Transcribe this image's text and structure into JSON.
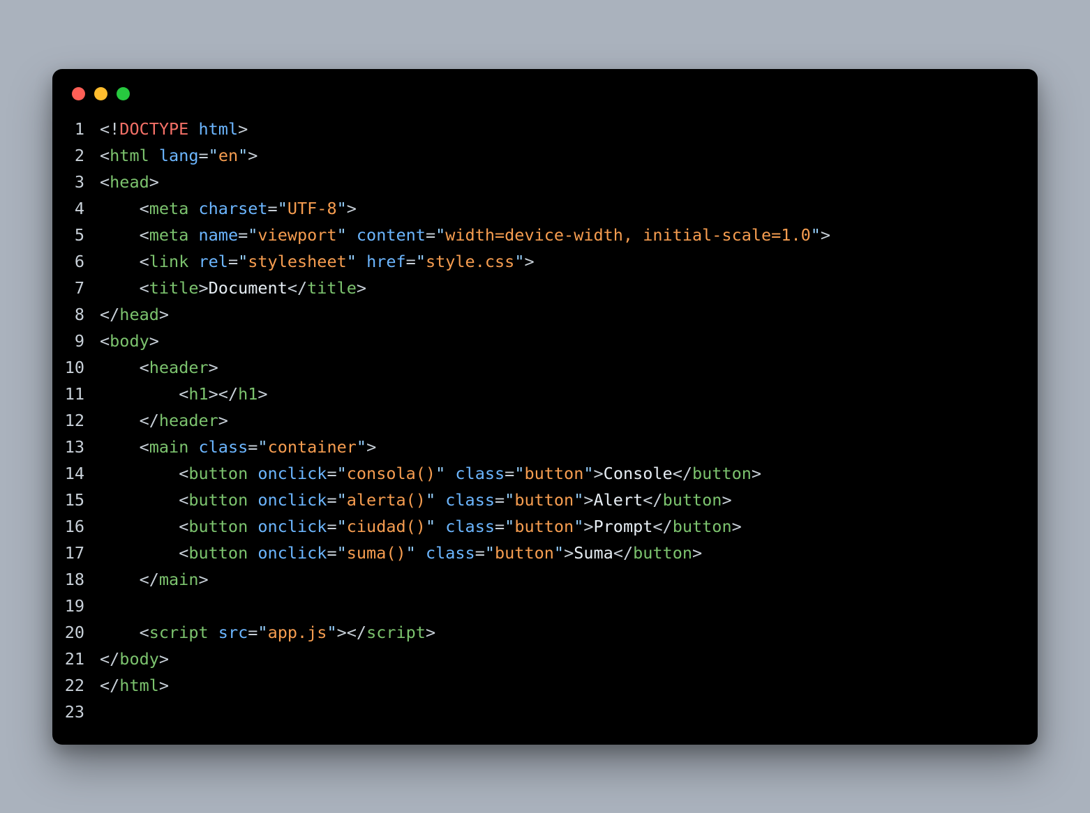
{
  "window": {
    "dots": {
      "red": "#ff5f56",
      "yellow": "#ffbd2e",
      "green": "#27c93f"
    }
  },
  "gutter": {
    "l1": "1",
    "l2": "2",
    "l3": "3",
    "l4": "4",
    "l5": "5",
    "l6": "6",
    "l7": "7",
    "l8": "8",
    "l9": "9",
    "l10": "10",
    "l11": "11",
    "l12": "12",
    "l13": "13",
    "l14": "14",
    "l15": "15",
    "l16": "16",
    "l17": "17",
    "l18": "18",
    "l19": "19",
    "l20": "20",
    "l21": "21",
    "l22": "22",
    "l23": "23"
  },
  "tok": {
    "lt": "<",
    "gt": ">",
    "ltbang": "<!",
    "ltsl": "</",
    "eq": "=",
    "q": "\"",
    "doctype": "DOCTYPE",
    "html_word": "html",
    "html": "html",
    "head": "head",
    "meta": "meta",
    "link": "link",
    "title": "title",
    "body": "body",
    "header": "header",
    "h1": "h1",
    "main": "main",
    "button": "button",
    "script": "script",
    "attrs": {
      "lang": "lang",
      "charset": "charset",
      "name": "name",
      "content": "content",
      "rel": "rel",
      "href": "href",
      "class": "class",
      "onclick": "onclick",
      "src": "src"
    },
    "vals": {
      "en": "en",
      "utf8": "UTF-8",
      "viewport": "viewport",
      "viewport_content": "width=device-width, initial-scale=1.0",
      "stylesheet": "stylesheet",
      "stylecss": "style.css",
      "container": "container",
      "consola": "consola()",
      "alerta": "alerta()",
      "ciudad": "ciudad()",
      "suma": "suma()",
      "button": "button",
      "appjs": "app.js"
    },
    "text": {
      "document": "Document",
      "console": "Console",
      "alert": "Alert",
      "prompt": "Prompt",
      "suma": "Suma"
    },
    "indent": {
      "i1": "    ",
      "i2": "        ",
      "i3": "            "
    },
    "sp": " "
  }
}
